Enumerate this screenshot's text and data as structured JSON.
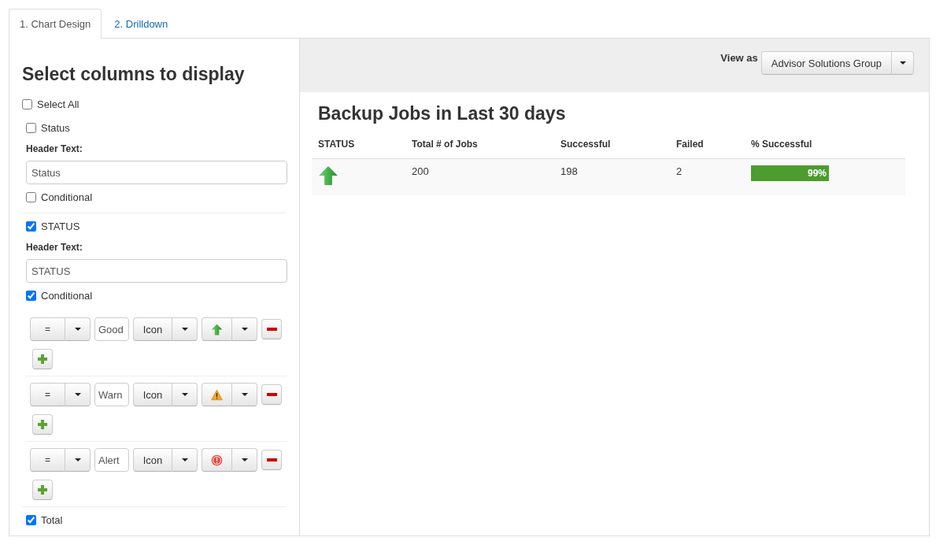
{
  "tabs": [
    {
      "label": "1. Chart Design",
      "selected": true
    },
    {
      "label": "2. Drilldown",
      "selected": false
    }
  ],
  "column_panel": {
    "title": "Select columns to display",
    "select_all": {
      "label": "Select All",
      "checked": false
    },
    "columns": [
      {
        "label": "Status",
        "checked": false,
        "header_label": "Header Text:",
        "header_text": "Status",
        "conditional": {
          "label": "Conditional",
          "checked": false
        }
      },
      {
        "label": "STATUS",
        "checked": true,
        "header_label": "Header Text:",
        "header_text": "STATUS",
        "conditional": {
          "label": "Conditional",
          "checked": true
        },
        "rules": [
          {
            "operator": "=",
            "value": "Good",
            "display": "Icon",
            "kind": "up-arrow"
          },
          {
            "operator": "=",
            "value": "Warn",
            "display": "Icon",
            "kind": "warning"
          },
          {
            "operator": "=",
            "value": "Alert",
            "display": "Icon",
            "kind": "alert"
          }
        ]
      },
      {
        "label": "Total",
        "checked": true
      }
    ]
  },
  "view_as": {
    "label": "View as",
    "value": "Advisor Solutions Group"
  },
  "report": {
    "title": "Backup Jobs in Last 30 days",
    "columns": [
      "STATUS",
      "Total # of Jobs",
      "Successful",
      "Failed",
      "% Successful"
    ],
    "rows": [
      {
        "kind": "up-arrow",
        "total": "200",
        "successful": "198",
        "failed": "2",
        "percent": {
          "level": 0.99,
          "text": "99%"
        }
      }
    ]
  }
}
